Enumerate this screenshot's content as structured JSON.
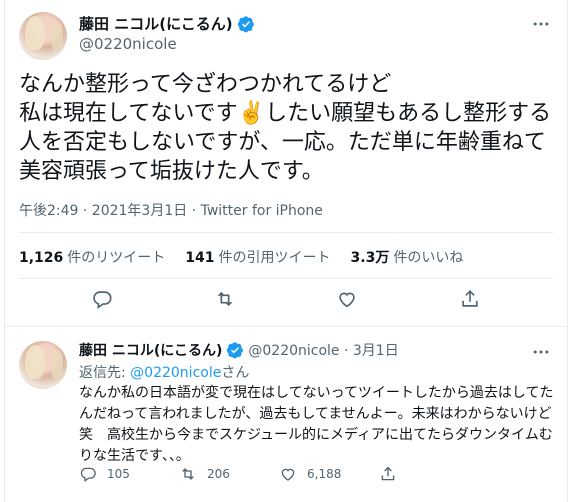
{
  "main": {
    "display_name": "藤田 ニコル(にこるん)",
    "handle": "@0220nicole",
    "text": "なんか整形って今ざわつかれてるけど\n私は現在してないです✌️したい願望もあるし整形する人を否定もしないですが、一応。ただ単に年齢重ねて美容頑張って垢抜けた人です。",
    "time": "午後2:49 · 2021年3月1日",
    "sep": " · ",
    "source": "Twitter for iPhone",
    "stats": [
      {
        "count": "1,126",
        "label": "件のリツイート"
      },
      {
        "count": "141",
        "label": "件の引用ツイート"
      },
      {
        "count": "3.3万",
        "label": "件のいいね"
      }
    ]
  },
  "reply": {
    "display_name": "藤田 ニコル(にこるん)",
    "handle_date": "@0220nicole · 3月1日",
    "replying_prefix": "返信先: ",
    "replying_mention": "@0220nicole",
    "replying_suffix": "さん",
    "text": "なんか私の日本語が変で現在はしてないってツイートしたから過去はしてたんだねって言われましたが、過去もしてませんよー。未来はわからないけど笑　高校生から今までスケジュール的にメディアに出てたらダウンタイムむりな生活です、、。",
    "replies": "105",
    "retweets": "206",
    "likes": "6,188"
  },
  "colors": {
    "accent": "#1d9bf0",
    "text": "#0f1419",
    "muted": "#536471",
    "border": "#e6ecf0"
  },
  "icons": [
    "verified-badge-icon",
    "more-icon",
    "reply-icon",
    "retweet-icon",
    "like-icon",
    "share-icon"
  ]
}
